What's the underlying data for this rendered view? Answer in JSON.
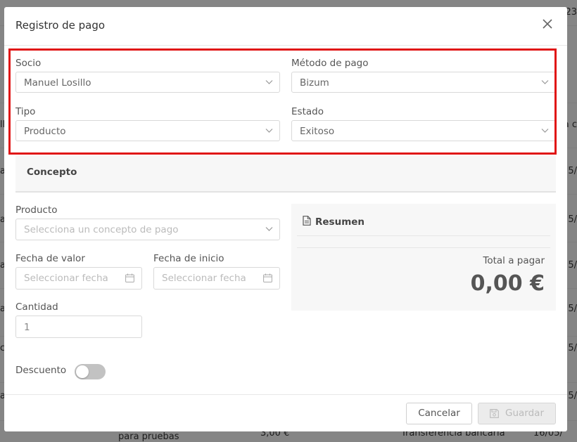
{
  "background": {
    "left_cells": [
      "ll",
      "a",
      "a",
      "a",
      "a",
      "ci",
      "a",
      "a"
    ],
    "right_cells": [
      "23",
      "a c",
      "5/",
      "5/",
      "5/",
      "5/",
      "5/",
      "5/"
    ],
    "bottom_amount": "3,00 €",
    "bottom_method": "Transferencia bancaria",
    "bottom_date": "16/05/",
    "bottom_concept": "para pruebas"
  },
  "modal": {
    "title": "Registro de pago",
    "close_icon": "close-icon",
    "fields": {
      "socio": {
        "label": "Socio",
        "value": "Manuel Losillo"
      },
      "metodo": {
        "label": "Método de pago",
        "value": "Bizum"
      },
      "tipo": {
        "label": "Tipo",
        "value": "Producto"
      },
      "estado": {
        "label": "Estado",
        "value": "Exitoso"
      }
    },
    "concept": {
      "title": "Concepto",
      "producto": {
        "label": "Producto",
        "placeholder": "Selecciona un concepto de pago"
      },
      "fecha_valor": {
        "label": "Fecha de valor",
        "placeholder": "Seleccionar fecha"
      },
      "fecha_inicio": {
        "label": "Fecha de inicio",
        "placeholder": "Seleccionar fecha"
      },
      "cantidad": {
        "label": "Cantidad",
        "value": "1"
      },
      "descuento": {
        "label": "Descuento",
        "enabled": false
      }
    },
    "summary": {
      "title": "Resumen",
      "total_label": "Total a pagar",
      "total_value": "0,00 €"
    },
    "footer": {
      "cancel_label": "Cancelar",
      "save_label": "Guardar"
    }
  },
  "colors": {
    "highlight_border": "#e01515",
    "toggle_off": "#c2c2c2"
  }
}
